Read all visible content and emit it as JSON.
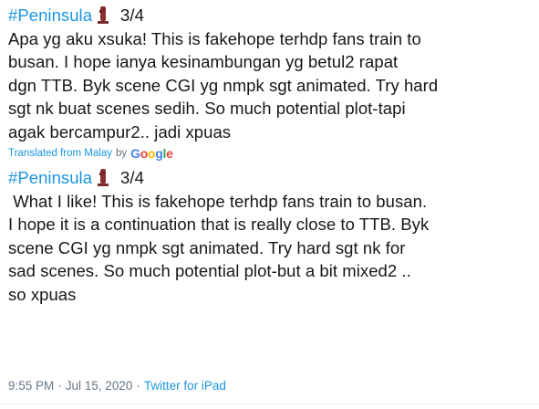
{
  "original": {
    "hashtag": "#Peninsula",
    "emoji": "moai-figure",
    "fraction": "3/4",
    "lines": [
      "Apa yg aku xsuka! This is fakehope terhdp fans train to",
      "busan. I hope ianya kesinambungan yg betul2 rapat",
      "dgn TTB. Byk scene CGI yg nmpk sgt animated. Try hard",
      "sgt nk buat scenes sedih. So much potential plot-tapi",
      "agak bercampur2.. jadi xpuas"
    ]
  },
  "translation_note": {
    "label": "Translated from Malay",
    "by": "by",
    "provider": "Google"
  },
  "translated": {
    "hashtag": "#Peninsula",
    "emoji": "moai-figure",
    "fraction": "3/4",
    "lines": [
      " What I like! This is fakehope terhdp fans train to busan.",
      "I hope it is a continuation that is really close to TTB. Byk",
      "scene CGI yg nmpk sgt animated. Try hard sgt nk for",
      "sad scenes. So much potential plot-but a bit mixed2 ..",
      "so xpuas"
    ]
  },
  "meta": {
    "time": "9:55 PM",
    "dot1": "·",
    "date": "Jul 15, 2020",
    "dot2": "·",
    "source": "Twitter for iPad"
  },
  "colors": {
    "link": "#1b95e0",
    "muted": "#657786",
    "text": "#14171a"
  }
}
